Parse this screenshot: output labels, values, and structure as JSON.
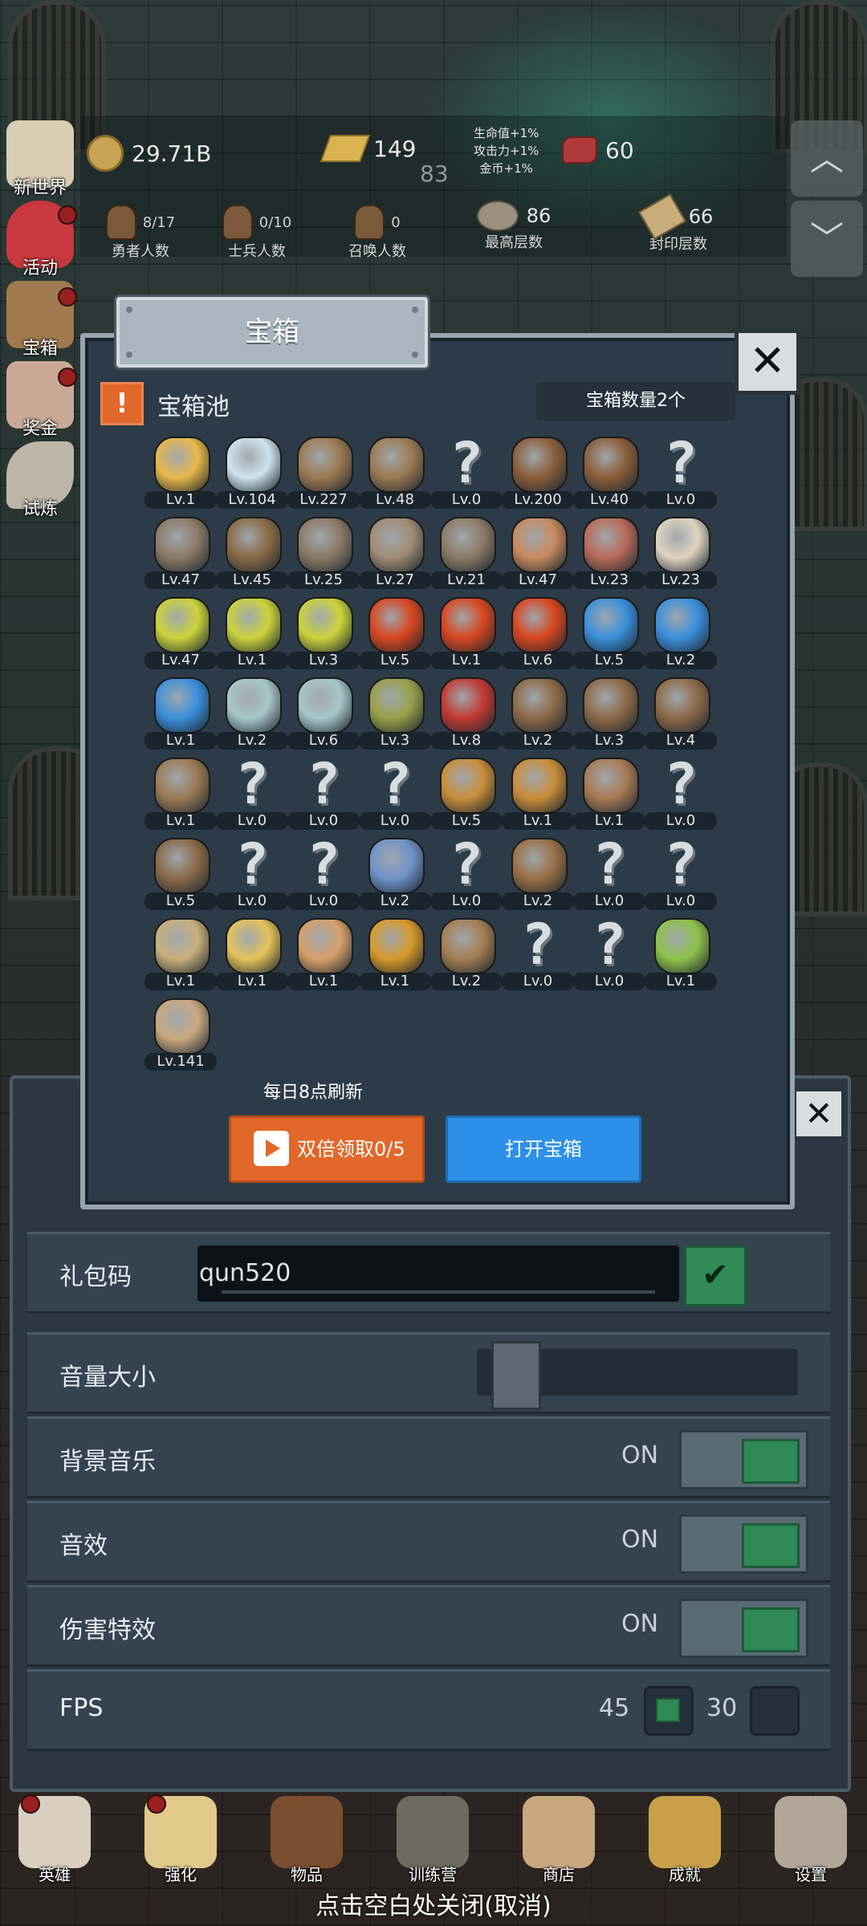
{
  "hud": {
    "gold": "29.71B",
    "gold_bars": "149",
    "sub_value": "83",
    "buffs": [
      "生命值+1%",
      "攻击力+1%",
      "金币+1%"
    ],
    "gems": "60",
    "hero_count": "8/17",
    "hero_label": "勇者人数",
    "soldier_count": "0/10",
    "soldier_label": "士兵人数",
    "summon_count": "0",
    "summon_label": "召唤人数",
    "max_floor": "86",
    "max_floor_label": "最高层数",
    "sealed_floor": "66",
    "sealed_floor_label": "封印层数"
  },
  "side_menu": [
    {
      "label": "新世界",
      "icon": "new-world-icon"
    },
    {
      "label": "活动",
      "icon": "heart-icon"
    },
    {
      "label": "宝箱",
      "icon": "chest-icon"
    },
    {
      "label": "奖金",
      "icon": "envelope-icon"
    },
    {
      "label": "试炼",
      "icon": "quill-icon"
    }
  ],
  "modal": {
    "title": "宝箱",
    "pool_title": "宝箱池",
    "chest_count": "宝箱数量2个",
    "refresh_note": "每日8点刷新",
    "double_button": "双倍领取0/5",
    "open_button": "打开宝箱"
  },
  "items": [
    {
      "lv": "Lv.1",
      "icon": "crown-icon"
    },
    {
      "lv": "Lv.104",
      "icon": "diamond-icon"
    },
    {
      "lv": "Lv.227",
      "icon": "sword-icon"
    },
    {
      "lv": "Lv.48",
      "icon": "sword-icon"
    },
    {
      "lv": "Lv.0",
      "icon": "unknown-icon"
    },
    {
      "lv": "Lv.200",
      "icon": "armor-icon"
    },
    {
      "lv": "Lv.40",
      "icon": "armor-icon"
    },
    {
      "lv": "Lv.0",
      "icon": "unknown-icon"
    },
    {
      "lv": "Lv.47",
      "icon": "helmet-icon"
    },
    {
      "lv": "Lv.45",
      "icon": "dagger-icon"
    },
    {
      "lv": "Lv.25",
      "icon": "helmet-icon"
    },
    {
      "lv": "Lv.27",
      "icon": "hammer-icon"
    },
    {
      "lv": "Lv.21",
      "icon": "helmet-icon"
    },
    {
      "lv": "Lv.47",
      "icon": "ham-icon"
    },
    {
      "lv": "Lv.23",
      "icon": "steak-icon"
    },
    {
      "lv": "Lv.23",
      "icon": "bread-icon"
    },
    {
      "lv": "Lv.47",
      "icon": "potion-yellow-icon"
    },
    {
      "lv": "Lv.1",
      "icon": "potion-yellow-icon"
    },
    {
      "lv": "Lv.3",
      "icon": "potion-yellow-icon"
    },
    {
      "lv": "Lv.5",
      "icon": "potion-red-icon"
    },
    {
      "lv": "Lv.1",
      "icon": "potion-red-icon"
    },
    {
      "lv": "Lv.6",
      "icon": "potion-red-icon"
    },
    {
      "lv": "Lv.5",
      "icon": "potion-blue-icon"
    },
    {
      "lv": "Lv.2",
      "icon": "potion-blue-icon"
    },
    {
      "lv": "Lv.1",
      "icon": "potion-blue-icon"
    },
    {
      "lv": "Lv.2",
      "icon": "bottle-icon"
    },
    {
      "lv": "Lv.6",
      "icon": "bottle-icon"
    },
    {
      "lv": "Lv.3",
      "icon": "bottle-green-icon"
    },
    {
      "lv": "Lv.8",
      "icon": "bottle-red-icon"
    },
    {
      "lv": "Lv.2",
      "icon": "boot-icon"
    },
    {
      "lv": "Lv.3",
      "icon": "boot-icon"
    },
    {
      "lv": "Lv.4",
      "icon": "boot-icon"
    },
    {
      "lv": "Lv.1",
      "icon": "shield-icon"
    },
    {
      "lv": "Lv.0",
      "icon": "unknown-icon"
    },
    {
      "lv": "Lv.0",
      "icon": "unknown-icon"
    },
    {
      "lv": "Lv.0",
      "icon": "unknown-icon"
    },
    {
      "lv": "Lv.5",
      "icon": "torch-icon"
    },
    {
      "lv": "Lv.1",
      "icon": "torch-icon"
    },
    {
      "lv": "Lv.1",
      "icon": "mushroom-icon"
    },
    {
      "lv": "Lv.0",
      "icon": "unknown-icon"
    },
    {
      "lv": "Lv.5",
      "icon": "staff-icon"
    },
    {
      "lv": "Lv.0",
      "icon": "unknown-icon"
    },
    {
      "lv": "Lv.0",
      "icon": "unknown-icon"
    },
    {
      "lv": "Lv.2",
      "icon": "wand-blue-icon"
    },
    {
      "lv": "Lv.0",
      "icon": "unknown-icon"
    },
    {
      "lv": "Lv.2",
      "icon": "backpack-icon"
    },
    {
      "lv": "Lv.0",
      "icon": "unknown-icon"
    },
    {
      "lv": "Lv.0",
      "icon": "unknown-icon"
    },
    {
      "lv": "Lv.1",
      "icon": "club-icon"
    },
    {
      "lv": "Lv.1",
      "icon": "cheese-icon"
    },
    {
      "lv": "Lv.1",
      "icon": "pie-icon"
    },
    {
      "lv": "Lv.1",
      "icon": "honey-jar-icon"
    },
    {
      "lv": "Lv.2",
      "icon": "bow-icon"
    },
    {
      "lv": "Lv.0",
      "icon": "unknown-icon"
    },
    {
      "lv": "Lv.0",
      "icon": "unknown-icon"
    },
    {
      "lv": "Lv.1",
      "icon": "wand-green-icon"
    },
    {
      "lv": "Lv.141",
      "icon": "beer-mug-icon"
    }
  ],
  "settings": {
    "gift_label": "礼包码",
    "gift_value": "qun520",
    "volume_label": "音量大小",
    "volume_level": 0.06,
    "bgm_label": "背景音乐",
    "bgm_state": "ON",
    "sfx_label": "音效",
    "sfx_state": "ON",
    "damage_label": "伤害特效",
    "damage_state": "ON",
    "fps_label": "FPS",
    "fps_options": [
      "45",
      "30"
    ]
  },
  "bottom_nav": [
    {
      "label": "英雄",
      "icon": "skull-icon"
    },
    {
      "label": "强化",
      "icon": "candle-icon"
    },
    {
      "label": "物品",
      "icon": "book-icon"
    },
    {
      "label": "训练营",
      "icon": "lantern-icon"
    },
    {
      "label": "商店",
      "icon": "beer-mug-icon"
    },
    {
      "label": "成就",
      "icon": "key-icon"
    },
    {
      "label": "设置",
      "icon": "gear-icon"
    }
  ],
  "close_hint": "点击空白处关闭(取消)"
}
